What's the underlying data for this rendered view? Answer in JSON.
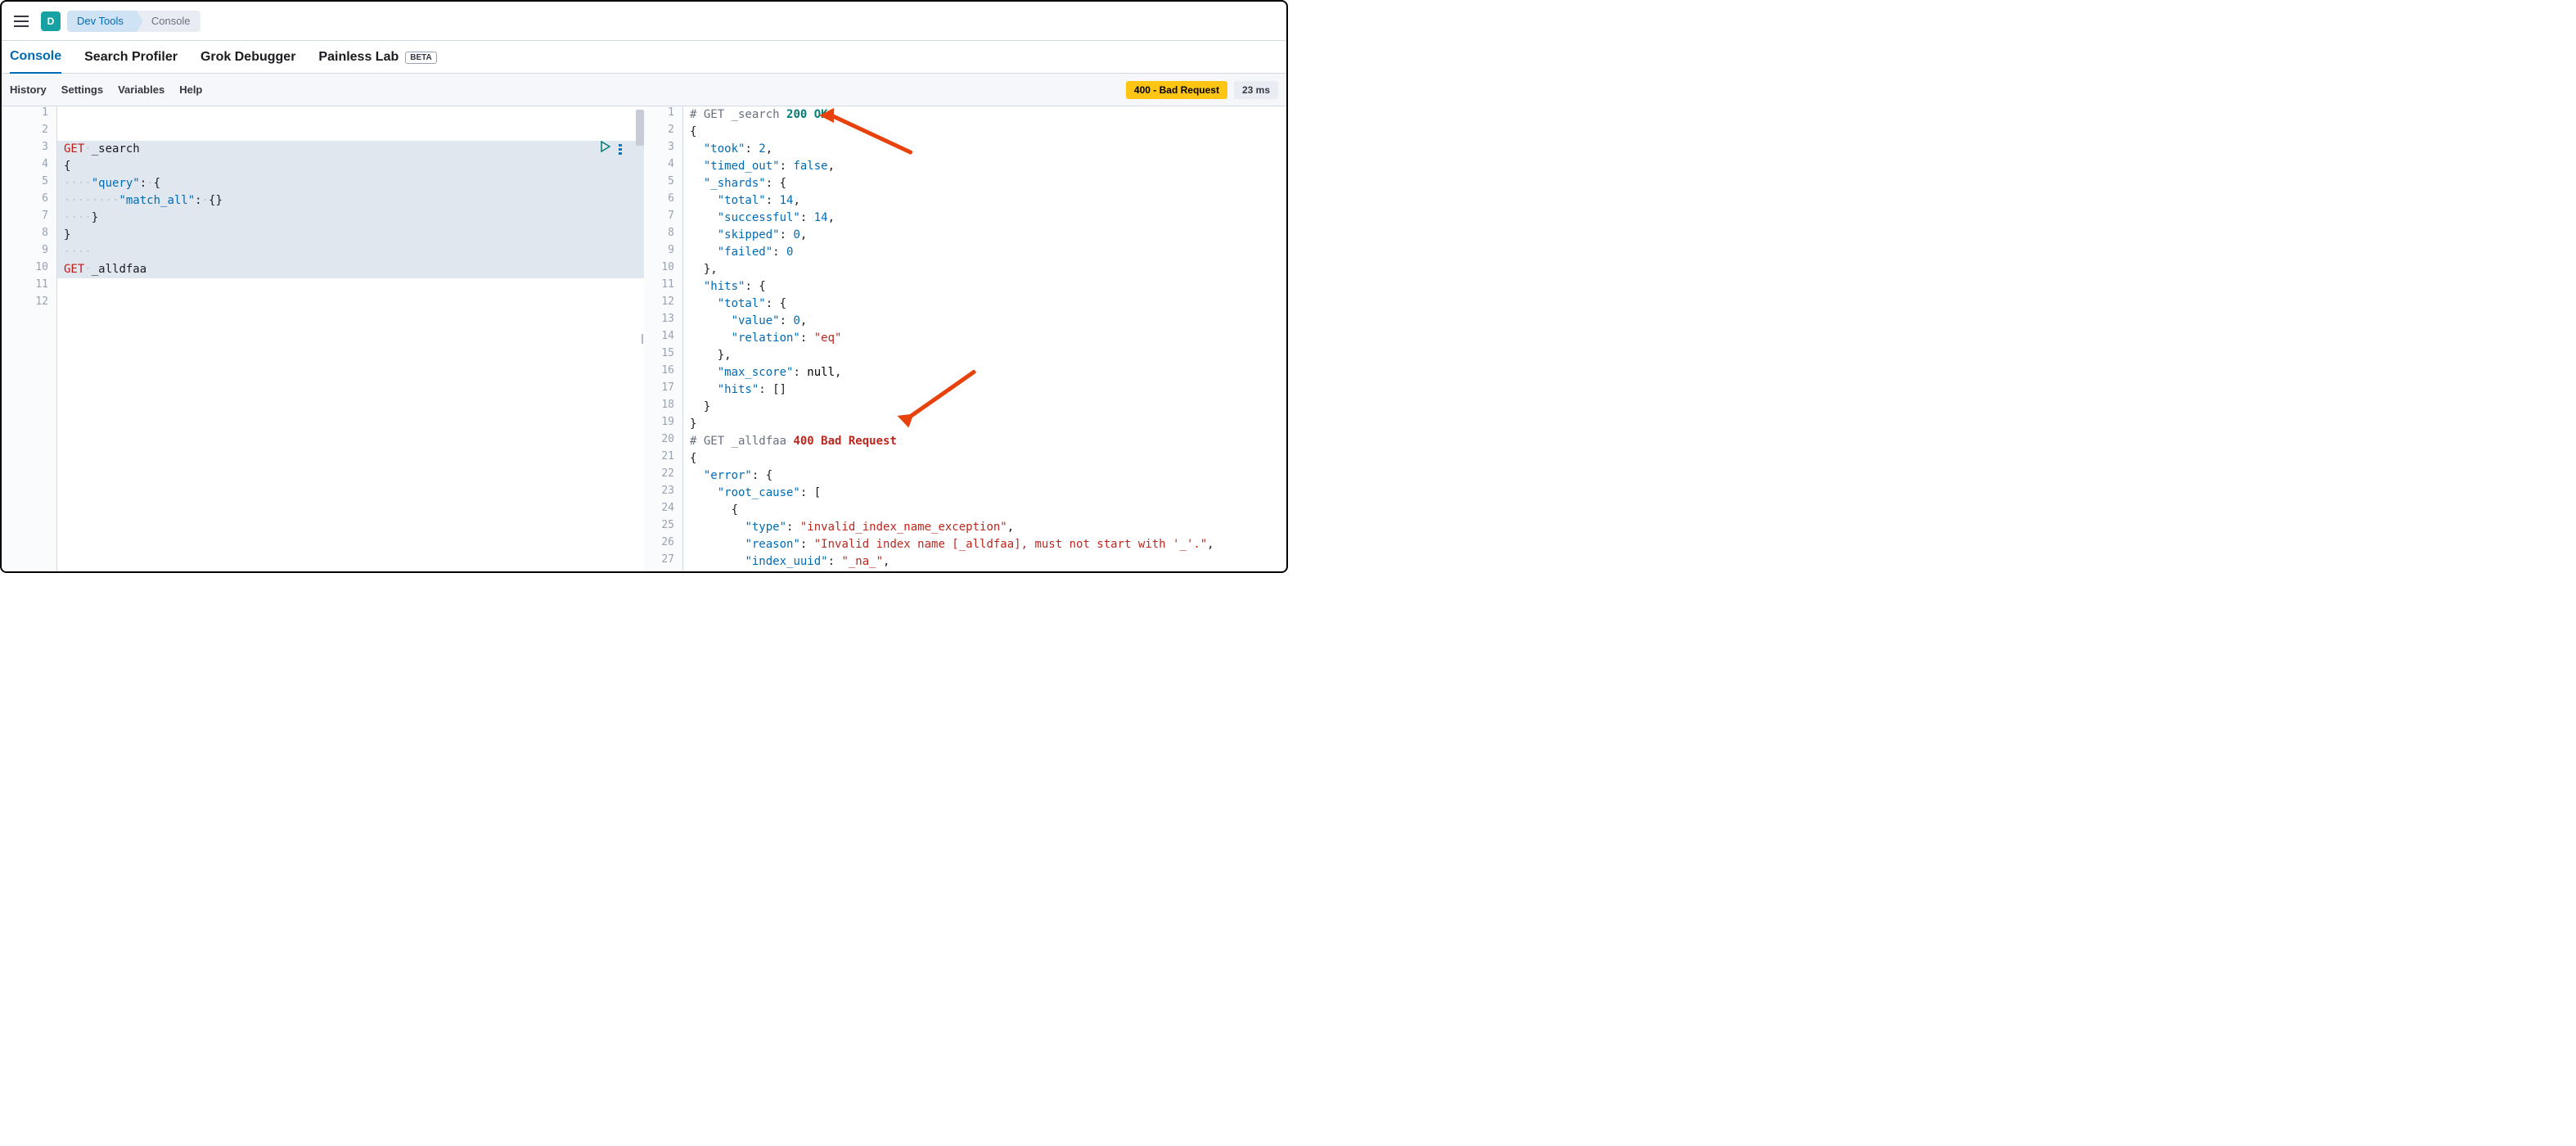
{
  "header": {
    "avatar_letter": "D",
    "breadcrumb": [
      "Dev Tools",
      "Console"
    ]
  },
  "tabs": [
    {
      "label": "Console",
      "active": true
    },
    {
      "label": "Search Profiler",
      "active": false
    },
    {
      "label": "Grok Debugger",
      "active": false
    },
    {
      "label": "Painless Lab",
      "active": false,
      "badge": "BETA"
    }
  ],
  "subbar": {
    "items": [
      "History",
      "Settings",
      "Variables",
      "Help"
    ],
    "status_badge": "400 - Bad Request",
    "time_badge": "23 ms"
  },
  "editor": {
    "lines": [
      {
        "n": 1,
        "html": ""
      },
      {
        "n": 2,
        "html": ""
      },
      {
        "n": 3,
        "html": "<span class='method'>GET</span><span class='dots'>·</span>_search",
        "sel": true
      },
      {
        "n": 4,
        "html": "{",
        "sel": true
      },
      {
        "n": 5,
        "html": "<span class='dots'>····</span><span class='key'>\"query\"</span>:<span class='dots'>·</span>{",
        "sel": true
      },
      {
        "n": 6,
        "html": "<span class='dots'>········</span><span class='key'>\"match_all\"</span>:<span class='dots'>·</span>{}",
        "sel": true
      },
      {
        "n": 7,
        "html": "<span class='dots'>····</span>}",
        "sel": true
      },
      {
        "n": 8,
        "html": "}",
        "sel": true
      },
      {
        "n": 9,
        "html": "<span class='dots'>····</span>",
        "sel": true
      },
      {
        "n": 10,
        "html": "<span class='method'>GET</span><span class='dots'>·</span>_alldfaa",
        "sel": true
      },
      {
        "n": 11,
        "html": ""
      },
      {
        "n": 12,
        "html": ""
      }
    ]
  },
  "output": {
    "lines": [
      {
        "n": 1,
        "html": "<span class='cm'># GET _search </span><span class='ok'>200 OK</span>"
      },
      {
        "n": 2,
        "html": "{"
      },
      {
        "n": 3,
        "html": "  <span class='key'>\"took\"</span>: <span class='val-num'>2</span>,"
      },
      {
        "n": 4,
        "html": "  <span class='key'>\"timed_out\"</span>: <span class='val-bool'>false</span>,"
      },
      {
        "n": 5,
        "html": "  <span class='key'>\"_shards\"</span>: {"
      },
      {
        "n": 6,
        "html": "    <span class='key'>\"total\"</span>: <span class='val-num'>14</span>,"
      },
      {
        "n": 7,
        "html": "    <span class='key'>\"successful\"</span>: <span class='val-num'>14</span>,"
      },
      {
        "n": 8,
        "html": "    <span class='key'>\"skipped\"</span>: <span class='val-num'>0</span>,"
      },
      {
        "n": 9,
        "html": "    <span class='key'>\"failed\"</span>: <span class='val-num'>0</span>"
      },
      {
        "n": 10,
        "html": "  },"
      },
      {
        "n": 11,
        "html": "  <span class='key'>\"hits\"</span>: {"
      },
      {
        "n": 12,
        "html": "    <span class='key'>\"total\"</span>: {"
      },
      {
        "n": 13,
        "html": "      <span class='key'>\"value\"</span>: <span class='val-num'>0</span>,"
      },
      {
        "n": 14,
        "html": "      <span class='key'>\"relation\"</span>: <span class='str'>\"eq\"</span>"
      },
      {
        "n": 15,
        "html": "    },"
      },
      {
        "n": 16,
        "html": "    <span class='key'>\"max_score\"</span>: <span class='val-null'>null</span>,"
      },
      {
        "n": 17,
        "html": "    <span class='key'>\"hits\"</span>: []"
      },
      {
        "n": 18,
        "html": "  }"
      },
      {
        "n": 19,
        "html": "}"
      },
      {
        "n": 20,
        "html": "<span class='cm'># GET _alldfaa </span><span class='err'>400 Bad Request</span>"
      },
      {
        "n": 21,
        "html": "{"
      },
      {
        "n": 22,
        "html": "  <span class='key'>\"error\"</span>: {"
      },
      {
        "n": 23,
        "html": "    <span class='key'>\"root_cause\"</span>: ["
      },
      {
        "n": 24,
        "html": "      {"
      },
      {
        "n": 25,
        "html": "        <span class='key'>\"type\"</span>: <span class='str'>\"invalid_index_name_exception\"</span>,"
      },
      {
        "n": 26,
        "html": "        <span class='key'>\"reason\"</span>: <span class='str'>\"Invalid index name [_alldfaa], must not start with '_'.\"</span>,"
      },
      {
        "n": 27,
        "html": "        <span class='key'>\"index_uuid\"</span>: <span class='str'>\"_na_\"</span>,"
      }
    ]
  }
}
